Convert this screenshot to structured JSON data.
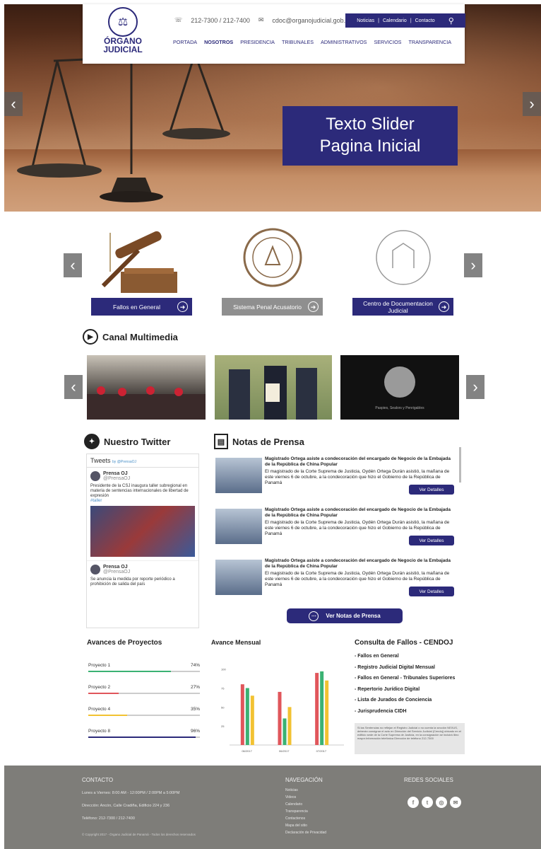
{
  "header": {
    "logo_line1": "ÓRGANO",
    "logo_line2": "JUDICIAL",
    "phone": "212-7300 / 212-7400",
    "email": "cdoc@organojudicial.gob.pa",
    "topbar": [
      "Noticias",
      "Calendario",
      "Contacto"
    ],
    "nav": [
      "PORTADA",
      "NOSOTROS",
      "PRESIDENCIA",
      "TRIBUNALES",
      "ADMINISTRATIVOS",
      "SERVICIOS",
      "TRANSPARENCIA"
    ]
  },
  "slider": {
    "line1": "Texto Slider",
    "line2": "Pagina Inicial"
  },
  "services": [
    {
      "label": "Fallos en General",
      "color": "#2c2a7a"
    },
    {
      "label": "Sistema Penal Acusatorio",
      "color": "#8f8f8f"
    },
    {
      "label": "Centro de Documentacion Judicial",
      "color": "#2c2a7a"
    }
  ],
  "multimedia": {
    "title": "Canal Multimedia",
    "video3_caption": "Paspies, Sealors y Penrigables"
  },
  "twitter": {
    "title": "Nuestro Twitter",
    "tweets_label": "Tweets",
    "by": "by @PrensaOJ",
    "tweet1_name": "Prensa OJ",
    "tweet1_handle": "@PrensaOJ",
    "tweet1_text": "Presidente de la CSJ inaugura taller subregional en materia de sentencias internacionales de libertad de expresión",
    "tweet1_link": "#taller",
    "tweet2_name": "Prensa OJ",
    "tweet2_handle": "@PrensaOJ",
    "tweet2_text": "Se anuncia la medida por reporte periódico a prohibición de salida del país"
  },
  "press": {
    "title": "Notas de Prensa",
    "button": "Ver Notas de Prensa",
    "items": [
      {
        "title": "Magistrado Ortega asiste a condecoración del encargado de Negocio de la Embajada de la República de China Popular",
        "text": "El magistrado de la Corte Suprema de Justicia, Oydén Ortega Durán asistió, la mañana de este viernes 6 de octubre, a la condecoración que hizo el Gobierno de la República de Panamá",
        "btn": "Ver Detalles"
      },
      {
        "title": "Magistrado Ortega asiste a condecoración del encargado de Negocio de la Embajada de la República de China Popular",
        "text": "El magistrado de la Corte Suprema de Justicia, Oydén Ortega Durán asistió, la mañana de este viernes 6 de octubre, a la condecoración que hizo el Gobierno de la República de Panamá",
        "btn": "Ver Detalles"
      },
      {
        "title": "Magistrado Ortega asiste a condecoración del encargado de Negocio de la Embajada de la República de China Popular",
        "text": "El magistrado de la Corte Suprema de Justicia, Oydén Ortega Durán asistió, la mañana de este viernes 6 de octubre, a la condecoración que hizo el Gobierno de la República de Panamá",
        "btn": "Ver Detalles"
      }
    ]
  },
  "projects": {
    "title": "Avances de Proyectos",
    "items": [
      {
        "name": "Proyecto 1",
        "pct": "74%",
        "value": 0.74,
        "color": "#3bb273"
      },
      {
        "name": "Proyecto 2",
        "pct": "27%",
        "value": 0.27,
        "color": "#e0565b"
      },
      {
        "name": "Proyecto 4",
        "pct": "35%",
        "value": 0.35,
        "color": "#f2c232"
      },
      {
        "name": "Proyecto 8",
        "pct": "96%",
        "value": 0.96,
        "color": "#2c2a7a"
      }
    ]
  },
  "chart_data": {
    "type": "bar",
    "title": "Avance Mensual",
    "categories": [
      "06/2017",
      "06/2017",
      "07/2017"
    ],
    "series": [
      {
        "values": [
          80,
          70,
          95
        ],
        "color": "#e0565b"
      },
      {
        "values": [
          75,
          35,
          97
        ],
        "color": "#3bb273"
      },
      {
        "values": [
          65,
          50,
          85
        ],
        "color": "#f2c232"
      }
    ],
    "yticks": [
      "100",
      "75",
      "50",
      "25"
    ],
    "ylim": [
      0,
      110
    ]
  },
  "cendoj": {
    "title": "Consulta de Fallos - CENDOJ",
    "items": [
      "Fallos en General",
      "Registro Judicial Digital Mensual",
      "Fallos en General - Tribunales Superiores",
      "Repertorio Jurídico Digital",
      "Lista de Jurados de Conciencia",
      "Jurisprudencia CIDH"
    ],
    "note": "Si las Sentencias no reflejan el Registro Judicial o no cuenta la sección NEXUS, deberán consignar el acto en Dirección del Servicio Judicial (Cendoj) ubicado en el edificio sede de la Corte Suprema de Justicia, en la consignación se incluirá libro mayor.Información telefónica Dirección de teléfono 212-7300"
  },
  "footer": {
    "contact_title": "CONTACTO",
    "hours": "Lunes a Viernes: 8:00 AM - 12:00PM / 2:00PM a 5:00PM",
    "address": "Dirección: Ancón, Calle Cradiña, Edificio 224 y 236",
    "phones": "Teléfono: 212-7300 / 212-7400",
    "copyright": "© Copyright 2017 - Órgano Judicial de Panamá - Todos los derechos reservados",
    "nav_title": "NAVEGACIÓN",
    "nav_items": [
      "Noticias",
      "Videos",
      "Calendario",
      "Transparencia",
      "Contactenos",
      "Mapa del sitio",
      "Declaración de Privacidad"
    ],
    "social_title": "REDES SOCIALES",
    "social": [
      "f",
      "t",
      "◎",
      "✉"
    ]
  }
}
